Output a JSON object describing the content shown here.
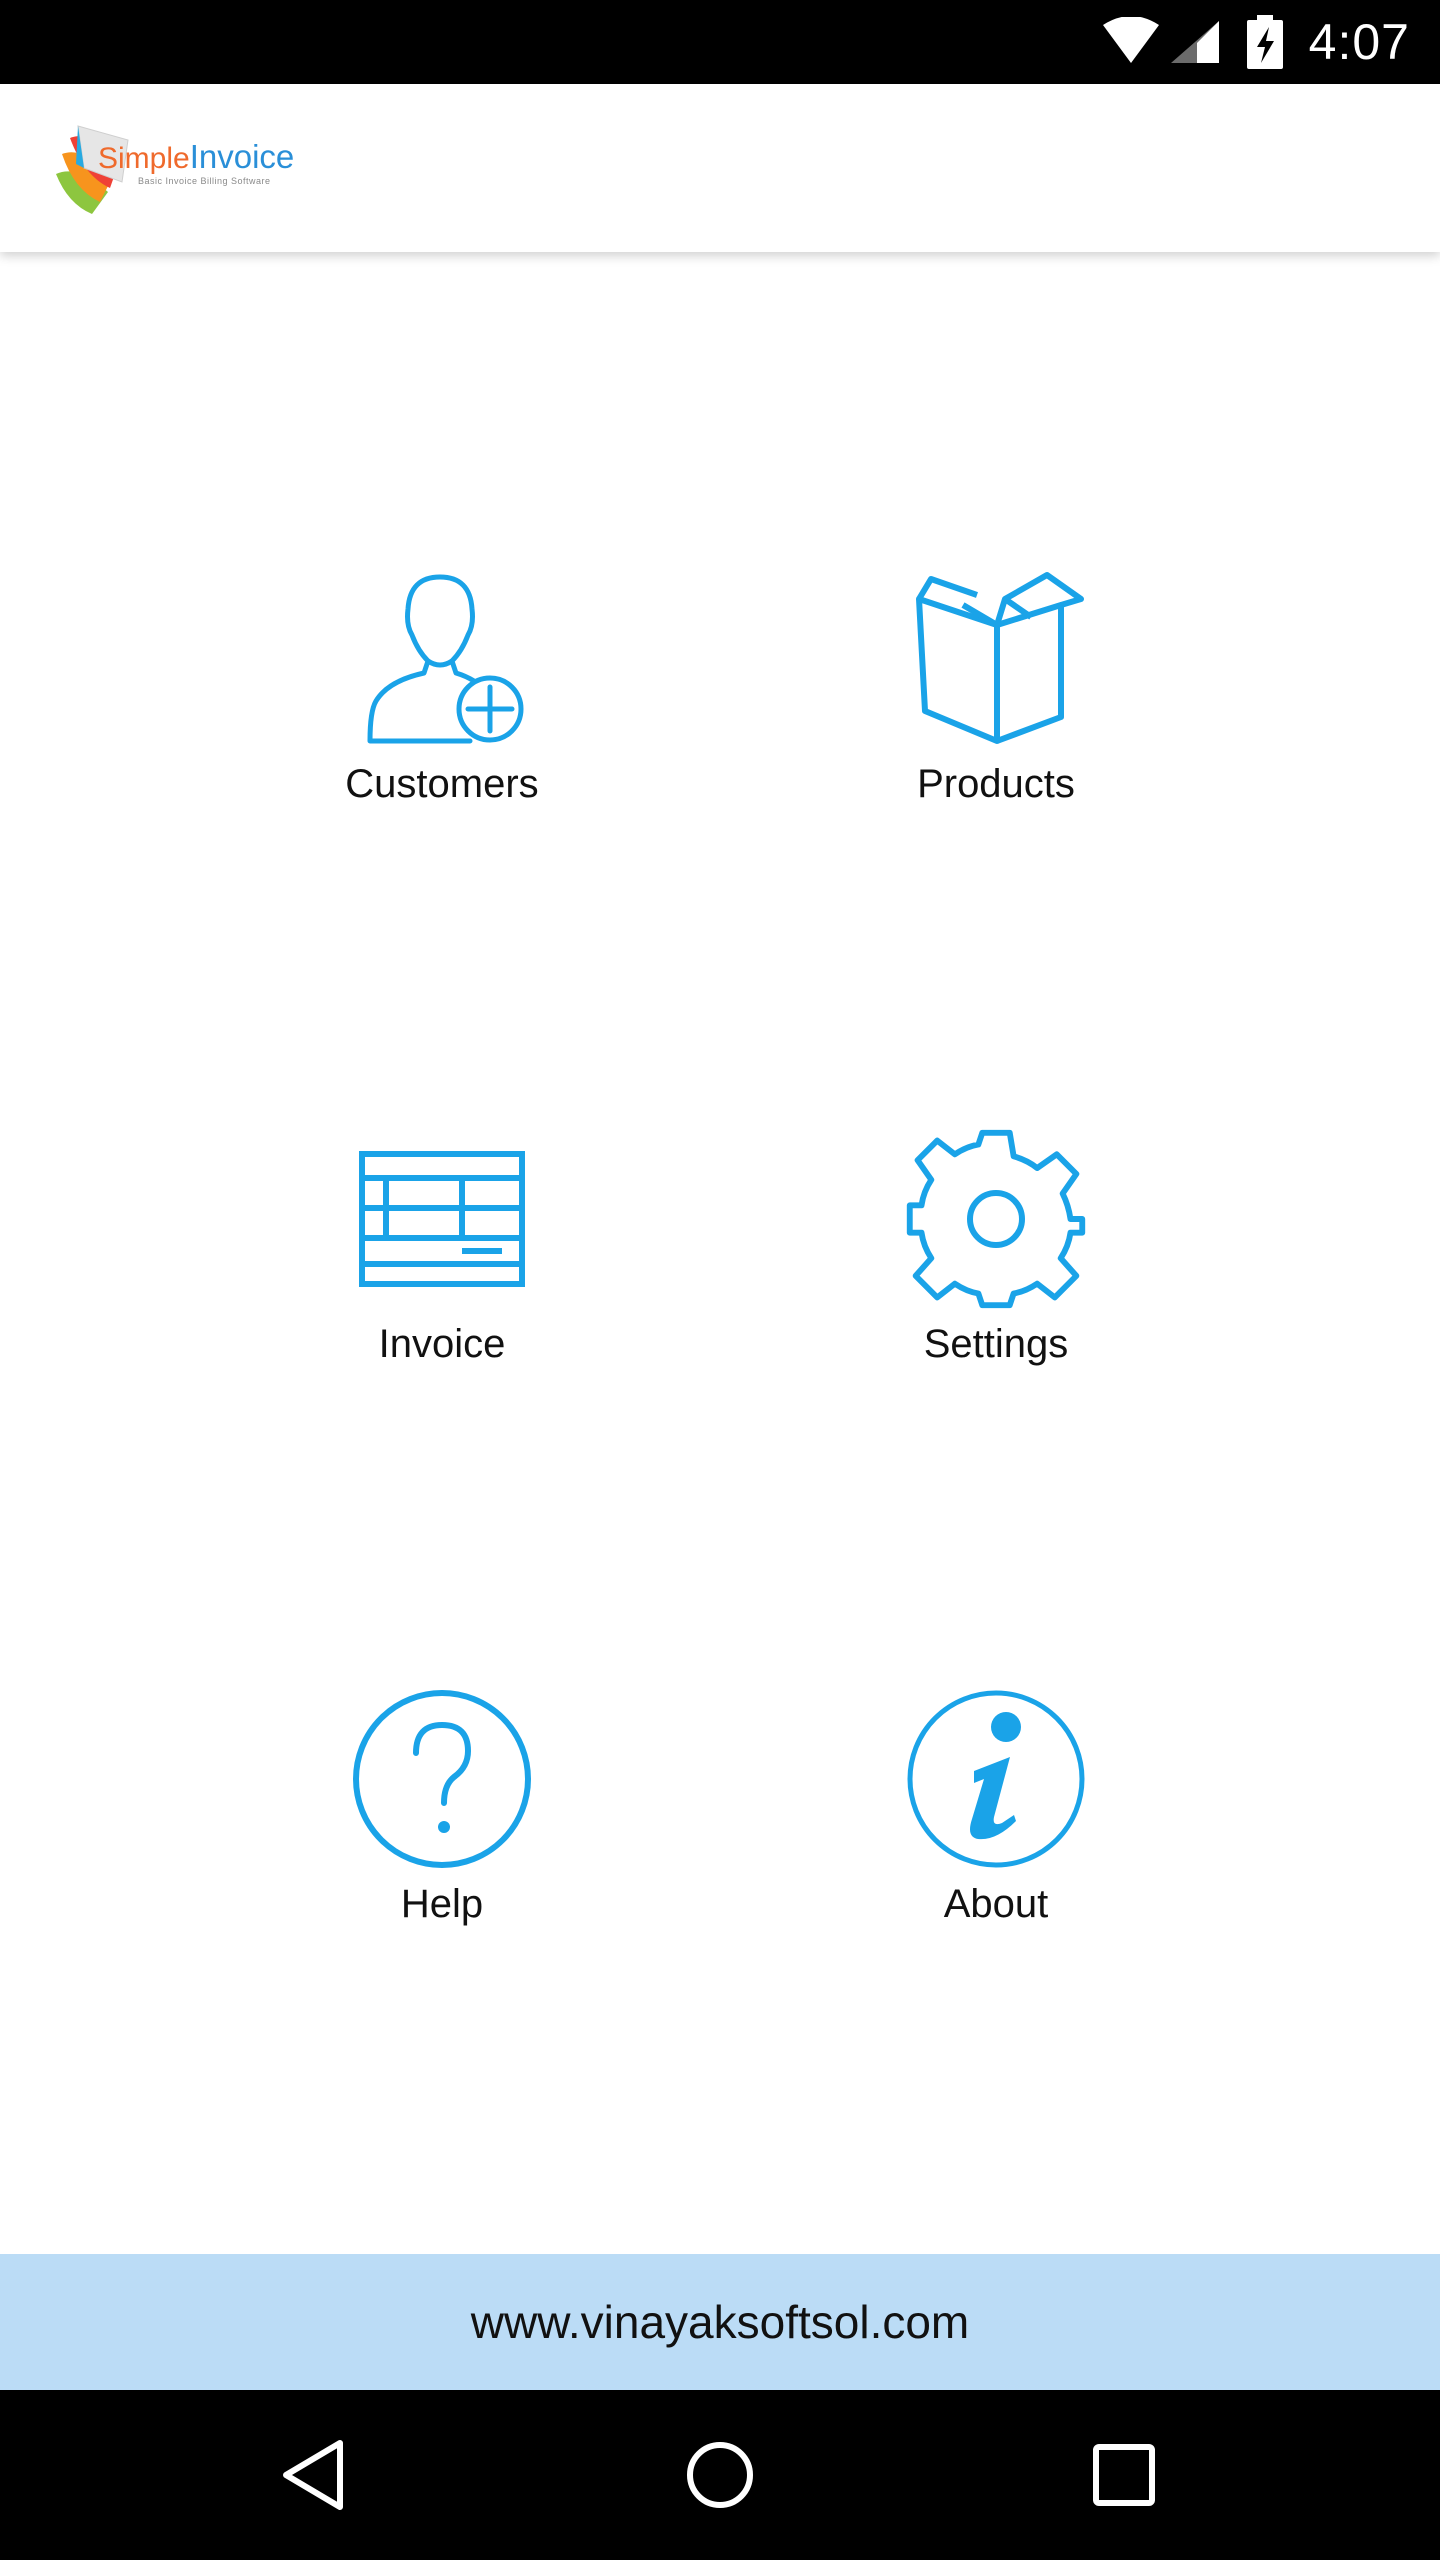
{
  "status_bar": {
    "time": "4:07",
    "icons": [
      "wifi-icon",
      "cell-signal-icon",
      "battery-charging-icon"
    ]
  },
  "app_bar": {
    "logo": {
      "word1": "Simple",
      "word2": "Invoice",
      "tagline": "Basic Invoice Billing Software"
    }
  },
  "menu": {
    "customers": {
      "label": "Customers",
      "icon": "add-user-icon"
    },
    "products": {
      "label": "Products",
      "icon": "box-icon"
    },
    "invoice": {
      "label": "Invoice",
      "icon": "invoice-table-icon"
    },
    "settings": {
      "label": "Settings",
      "icon": "gear-icon"
    },
    "help": {
      "label": "Help",
      "icon": "question-circle-icon"
    },
    "about": {
      "label": "About",
      "icon": "info-circle-icon"
    }
  },
  "footer": {
    "url": "www.vinayaksoftsol.com"
  },
  "nav_bar": {
    "buttons": [
      "back-icon",
      "home-icon",
      "recents-icon"
    ]
  },
  "colors": {
    "accent": "#1aa3e8",
    "footer_bg": "#bbdcf6",
    "status_bg": "#000000"
  }
}
